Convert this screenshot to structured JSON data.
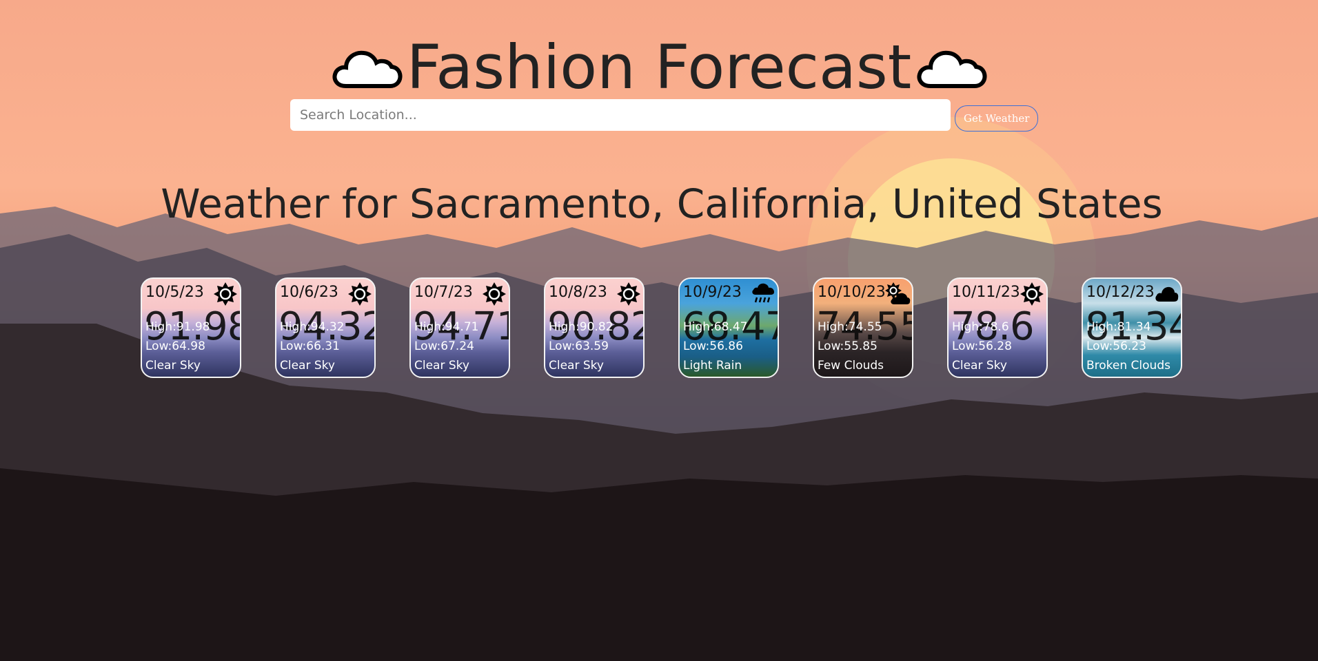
{
  "title": "Fashion Forecast",
  "search": {
    "placeholder": "Search Location...",
    "button_label": "Get Weather"
  },
  "location_heading": "Weather for Sacramento, California, United States",
  "forecast": [
    {
      "date": "10/5/23",
      "temp": "91.98",
      "high": "High:91.98",
      "low": "Low:64.98",
      "desc": "Clear Sky",
      "icon": "sun-icon"
    },
    {
      "date": "10/6/23",
      "temp": "94.32",
      "high": "High:94.32",
      "low": "Low:66.31",
      "desc": "Clear Sky",
      "icon": "sun-icon"
    },
    {
      "date": "10/7/23",
      "temp": "94.71",
      "high": "High:94.71",
      "low": "Low:67.24",
      "desc": "Clear Sky",
      "icon": "sun-icon"
    },
    {
      "date": "10/8/23",
      "temp": "90.82",
      "high": "High:90.82",
      "low": "Low:63.59",
      "desc": "Clear Sky",
      "icon": "sun-icon"
    },
    {
      "date": "10/9/23",
      "temp": "68.47",
      "high": "High:68.47",
      "low": "Low:56.86",
      "desc": "Light Rain",
      "icon": "rain-cloud-icon"
    },
    {
      "date": "10/10/23",
      "temp": "74.55",
      "high": "High:74.55",
      "low": "Low:55.85",
      "desc": "Few Clouds",
      "icon": "sun-cloud-icon"
    },
    {
      "date": "10/11/23",
      "temp": "78.6",
      "high": "High:78.6",
      "low": "Low:56.28",
      "desc": "Clear Sky",
      "icon": "sun-icon"
    },
    {
      "date": "10/12/23",
      "temp": "81.34",
      "high": "High:81.34",
      "low": "Low:56.23",
      "desc": "Broken Clouds",
      "icon": "cloud-icon"
    }
  ]
}
